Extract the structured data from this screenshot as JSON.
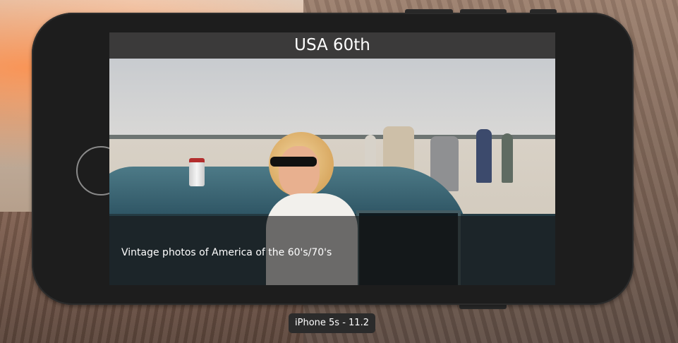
{
  "app": {
    "nav_title": "USA 60th",
    "caption": "Vintage photos of America of the 60's/70's"
  },
  "simulator": {
    "device_label": "iPhone 5s - 11.2"
  },
  "colors": {
    "phone_body": "#1d1d1d",
    "nav_bar": "#3b3a3a",
    "caption_overlay": "rgba(25,25,25,0.62)"
  }
}
